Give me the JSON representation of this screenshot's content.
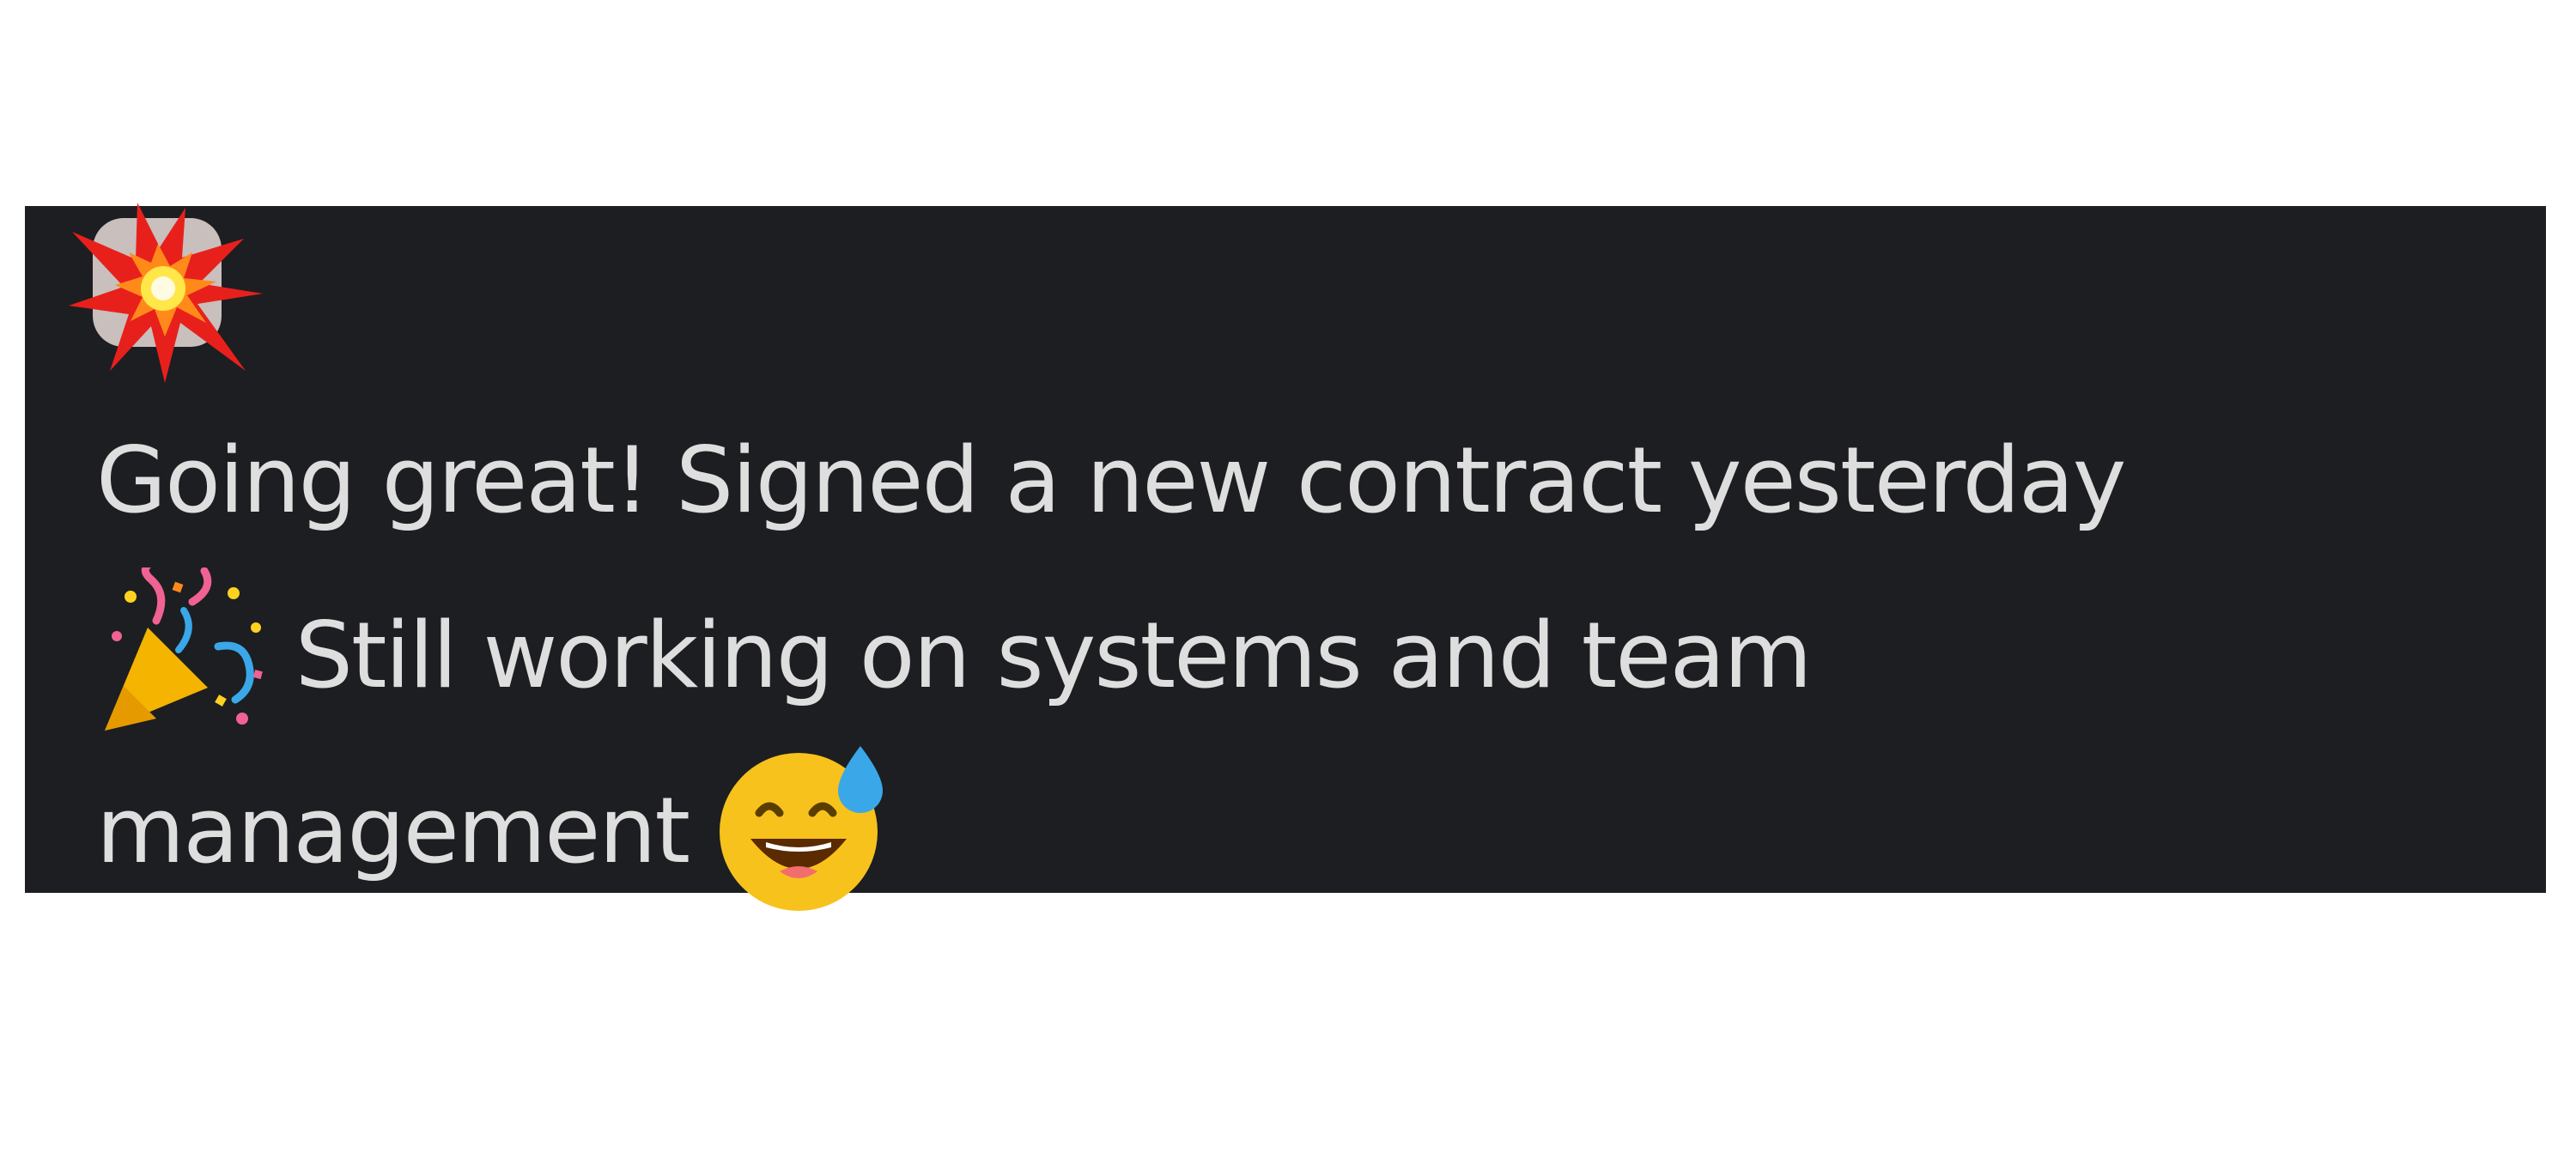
{
  "message": {
    "author_avatar_icon": "explosion-icon",
    "text_line_1": "Going great! Signed a new contract yesterday",
    "text_line_2_after_emoji": " Still working on systems and team",
    "text_line_3": "management ",
    "emoji_1": "party-popper-icon",
    "emoji_2": "grinning-sweat-icon"
  },
  "colors": {
    "page_background": "#ffffff",
    "card_background": "#1d1e21",
    "text": "#dedede",
    "avatar_background": "#c9bfbc",
    "burst_red": "#e8201c",
    "burst_yellow": "#ffd21f"
  }
}
